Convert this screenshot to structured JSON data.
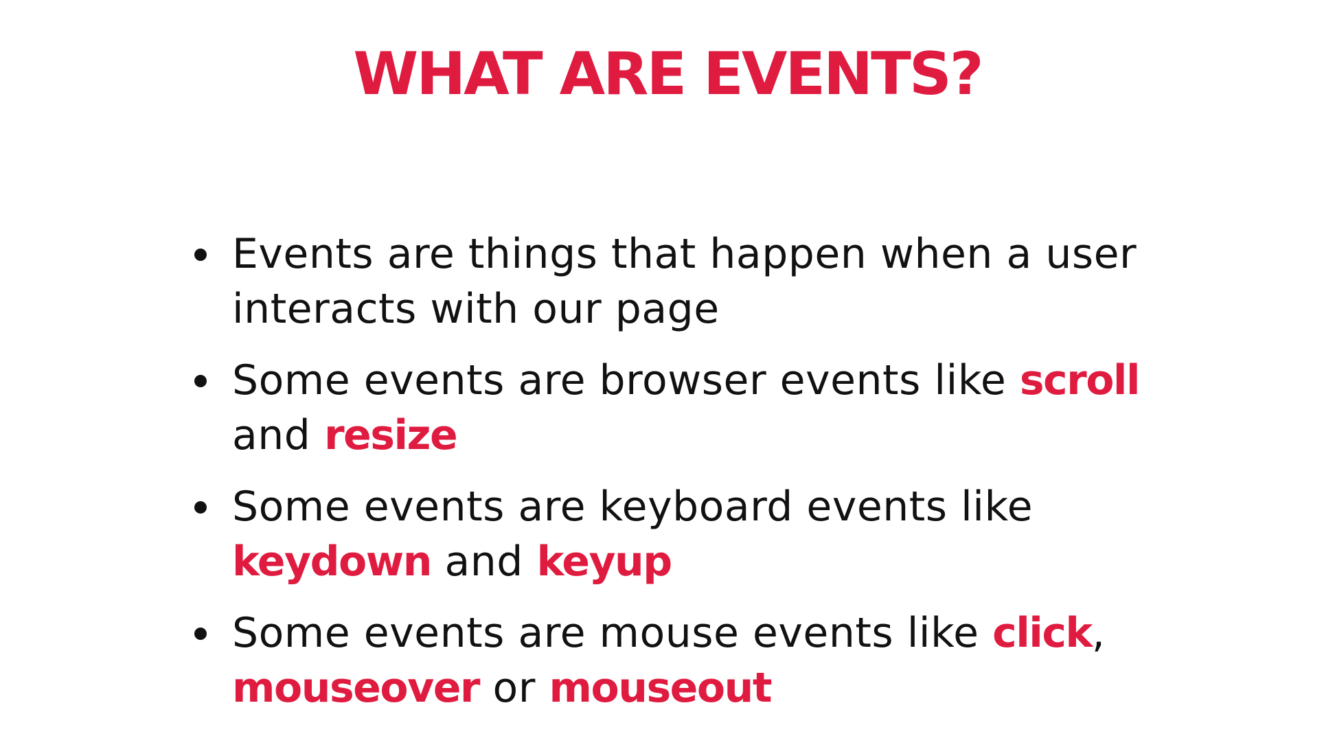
{
  "title": "WHAT ARE EVENTS?",
  "colors": {
    "accent": "#e01b40",
    "text": "#111111",
    "background": "#ffffff"
  },
  "bullets": [
    {
      "text": "Events are things that happen when a user interacts with our page"
    },
    {
      "text_a": "Some events are browser events like ",
      "kw1": "scroll",
      "text_b": " and ",
      "kw2": "resize"
    },
    {
      "text_a": "Some events are keyboard events like ",
      "kw1": "keydown",
      "text_b": " and ",
      "kw2": "keyup"
    },
    {
      "text_a": "Some events are mouse events like ",
      "kw1": "click",
      "text_b": ", ",
      "kw2": "mouseover",
      "text_c": " or ",
      "kw3": "mouseout"
    }
  ]
}
